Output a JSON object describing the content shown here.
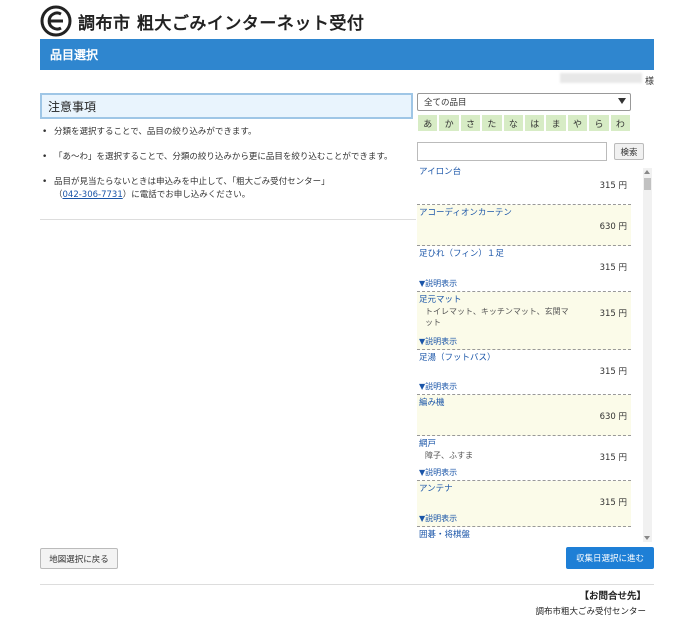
{
  "header": {
    "site_title": "調布市 粗大ごみインターネット受付"
  },
  "page_bar": {
    "title": "品目選択"
  },
  "user": {
    "suffix": "様"
  },
  "notice": {
    "title": "注意事項",
    "items": [
      "分類を選択することで、品目の絞り込みができます。",
      "「あ～わ」を選択することで、分類の絞り込みから更に品目を絞り込むことができます。",
      "品目が見当たらないときは申込みを中止して、「粗大ごみ受付センター」"
    ],
    "phone": "042-306-7731",
    "phone_prefix": "（",
    "phone_suffix": "）に電話でお申し込みください。"
  },
  "filter": {
    "category_selected": "全ての品目",
    "kana": [
      "あ",
      "か",
      "さ",
      "た",
      "な",
      "は",
      "ま",
      "や",
      "ら",
      "わ"
    ],
    "search_label": "検索",
    "search_value": ""
  },
  "items": [
    {
      "name": "アイロン台",
      "note": "",
      "price": "315 円",
      "desc": ""
    },
    {
      "name": "アコーディオンカーテン",
      "note": "",
      "price": "630 円",
      "desc": ""
    },
    {
      "name": "足ひれ（フィン）１足",
      "note": "",
      "price": "315 円",
      "desc": "▼説明表示"
    },
    {
      "name": "足元マット",
      "note": "トイレマット、キッチンマット、玄関マット",
      "price": "315 円",
      "desc": "▼説明表示"
    },
    {
      "name": "足湯（フットバス）",
      "note": "",
      "price": "315 円",
      "desc": "▼説明表示"
    },
    {
      "name": "編み機",
      "note": "",
      "price": "630 円",
      "desc": ""
    },
    {
      "name": "網戸",
      "note": "障子、ふすま",
      "price": "315 円",
      "desc": "▼説明表示"
    },
    {
      "name": "アンテナ",
      "note": "",
      "price": "315 円",
      "desc": "▼説明表示"
    },
    {
      "name": "囲碁・将棋盤",
      "note": "",
      "price": "",
      "desc": ""
    }
  ],
  "buttons": {
    "back": "地図選択に戻る",
    "next": "収集日選択に進む"
  },
  "footer": {
    "contact_title": "【お問合せ先】",
    "contact_name": "調布市粗大ごみ受付センター"
  },
  "colors": {
    "accent": "#2f86cf",
    "kana_bg": "#d7ecc5",
    "row_alt": "#fbfbe9",
    "link": "#1a55a8"
  }
}
